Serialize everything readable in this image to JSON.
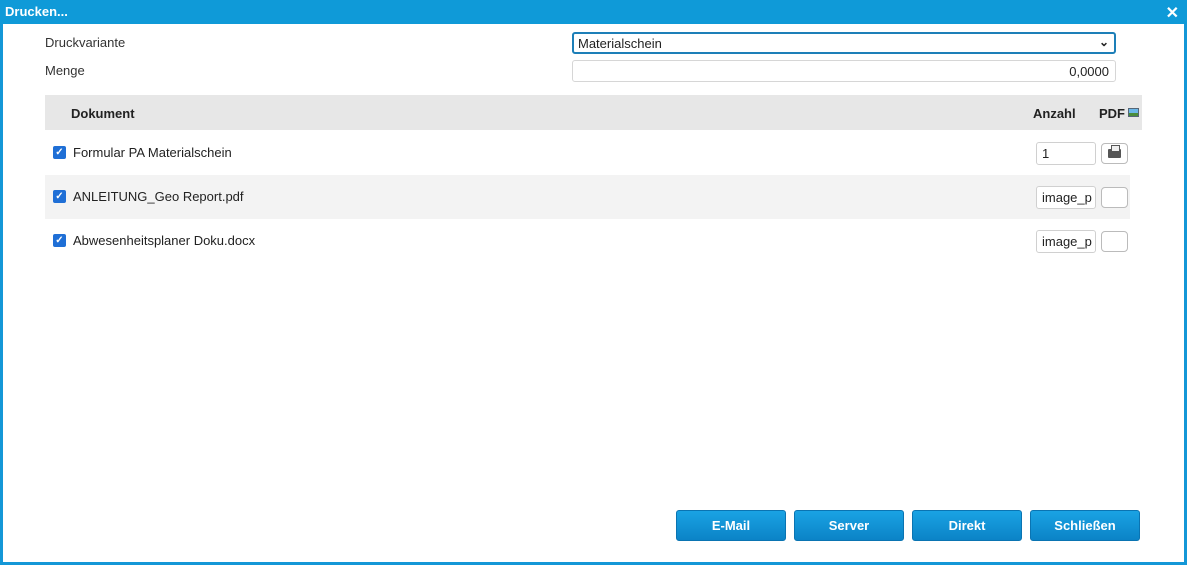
{
  "dialog": {
    "title": "Drucken...",
    "close_icon": "close-icon"
  },
  "form": {
    "druckvariante_label": "Druckvariante",
    "druckvariante_value": "Materialschein",
    "menge_label": "Menge",
    "menge_value": "0,0000"
  },
  "table": {
    "headers": {
      "dokument": "Dokument",
      "anzahl": "Anzahl",
      "pdf": "PDF"
    },
    "rows": [
      {
        "checked": true,
        "name": "Formular PA Materialschein",
        "anzahl": "1",
        "button_icon": "printer-icon"
      },
      {
        "checked": true,
        "name": "ANLEITUNG_Geo Report.pdf",
        "anzahl": "image_p",
        "button_icon": "empty"
      },
      {
        "checked": true,
        "name": "Abwesenheitsplaner Doku.docx",
        "anzahl": "image_p",
        "button_icon": "empty"
      }
    ]
  },
  "buttons": {
    "email": "E-Mail",
    "server": "Server",
    "direkt": "Direkt",
    "schliessen": "Schließen"
  },
  "colors": {
    "accent": "#0f9ad8",
    "button": "#1497d7",
    "header_bg": "#e7e7e7"
  }
}
